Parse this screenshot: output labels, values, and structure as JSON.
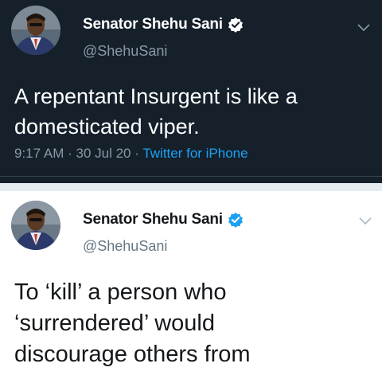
{
  "tweets": [
    {
      "author": {
        "name": "Senator Shehu Sani",
        "handle": "@ShehuSani",
        "verified": true
      },
      "text_lines": [
        "A repentant Insurgent is like a",
        "domesticated viper."
      ],
      "time": "9:17 AM",
      "date": "30 Jul 20",
      "source": "Twitter for iPhone",
      "theme": "dark"
    },
    {
      "author": {
        "name": "Senator Shehu Sani",
        "handle": "@ShehuSani",
        "verified": true
      },
      "text_lines": [
        "To ‘kill’ a person who",
        "‘surrendered’ would",
        "discourage others from"
      ],
      "theme": "light"
    }
  ],
  "colors": {
    "dark_bg": "#15202b",
    "dim_gray": "#8899a6",
    "twitter_blue": "#1da1f2",
    "light_text": "#14171a"
  },
  "icons": {
    "verified": "verified-badge-icon",
    "more": "chevron-down-icon"
  }
}
